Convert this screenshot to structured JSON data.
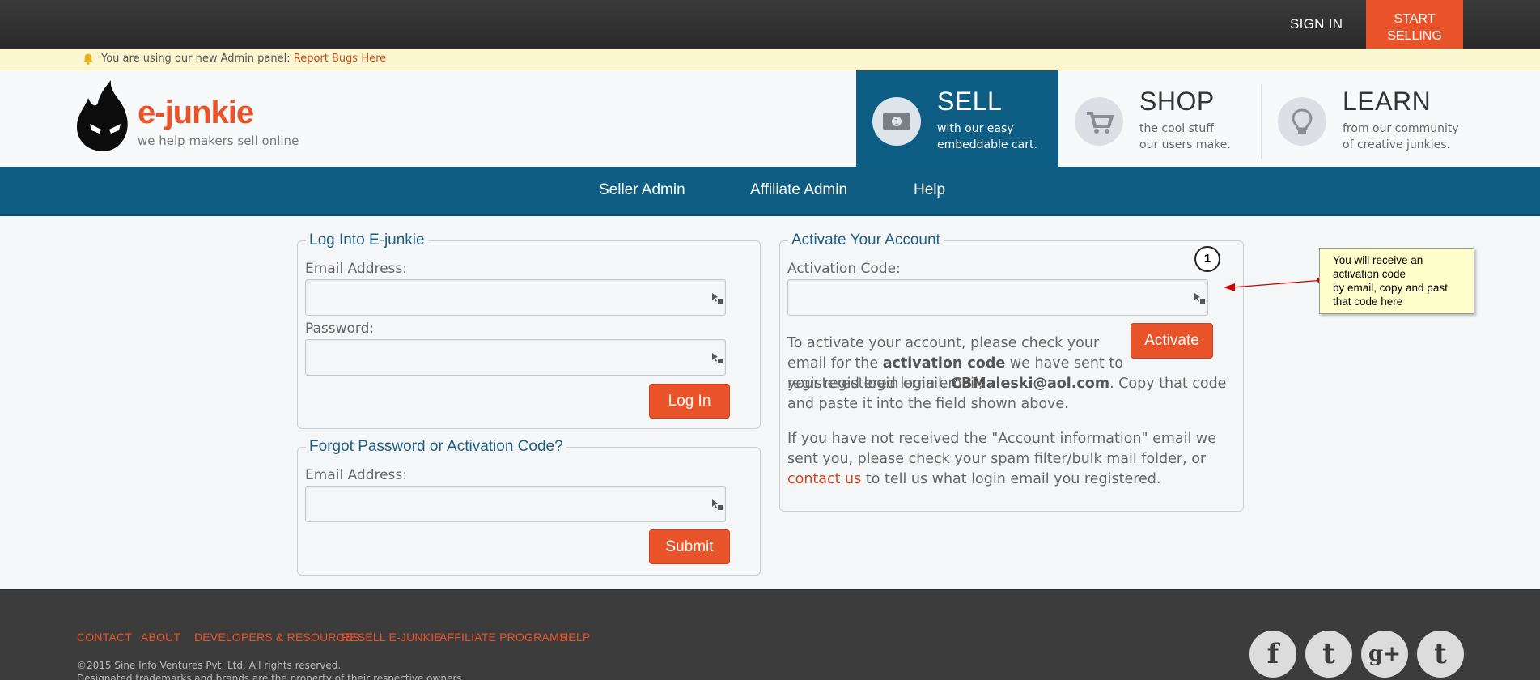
{
  "topbar": {
    "signin_label": "SIGN IN",
    "start_selling_line1": "START",
    "start_selling_line2": "SELLING"
  },
  "notice": {
    "text": "You are using our new Admin panel:",
    "link": "Report Bugs Here"
  },
  "logo": {
    "name": "e-junkie",
    "tagline": "we help makers sell online"
  },
  "header_nav": [
    {
      "title": "SELL",
      "sub1": "with our easy",
      "sub2": "embeddable cart."
    },
    {
      "title": "SHOP",
      "sub1": "the cool stuff",
      "sub2": "our users make."
    },
    {
      "title": "LEARN",
      "sub1": "from our community",
      "sub2": "of creative junkies."
    }
  ],
  "main_nav": [
    "Seller Admin",
    "Affiliate Admin",
    "Help"
  ],
  "login": {
    "legend": "Log Into E-junkie",
    "email_label": "Email Address:",
    "password_label": "Password:",
    "button": "Log In",
    "email_value": "",
    "password_value": ""
  },
  "forgot": {
    "legend": "Forgot Password or Activation Code?",
    "email_label": "Email Address:",
    "button": "Submit",
    "email_value": ""
  },
  "activate": {
    "legend": "Activate Your Account",
    "code_label": "Activation Code:",
    "code_value": "",
    "button": "Activate",
    "p1_a": "To activate your account, please check your email for the ",
    "p1_b": "activation code",
    "p1_c": " we have sent to your registered login email, ",
    "p1_email": "CBMaleski@aol.com",
    "p1_d": ". Copy that code and paste it into the field shown above.",
    "p2_a": "If you have not received the \"Account information\" email we sent you, please check your spam filter/bulk mail folder, or ",
    "p2_link": "contact us",
    "p2_b": " to tell us what login email you registered."
  },
  "annotation": {
    "step": "1",
    "line1": "You will receive an",
    "line2": "activation code",
    "line3": "by email, copy and past",
    "line4": "that code here"
  },
  "footer": {
    "links": [
      "CONTACT",
      "ABOUT",
      "DEVELOPERS & RESOURCES",
      "RESELL E-JUNKIE",
      "AFFILIATE PROGRAMS",
      "HELP"
    ],
    "copyright": "©2015 Sine Info Ventures Pvt. Ltd. All rights reserved.",
    "trademark": "Designated trademarks and brands are the property of their respective owners.",
    "social": [
      {
        "icon": "facebook-icon",
        "glyph": "f"
      },
      {
        "icon": "twitter-icon",
        "glyph": "t"
      },
      {
        "icon": "googleplus-icon",
        "glyph": "g+"
      },
      {
        "icon": "tumblr-icon",
        "glyph": "t"
      }
    ]
  },
  "colors": {
    "accent": "#e8532a",
    "nav_blue": "#0f5d83",
    "legend_blue": "#1e5f86"
  }
}
